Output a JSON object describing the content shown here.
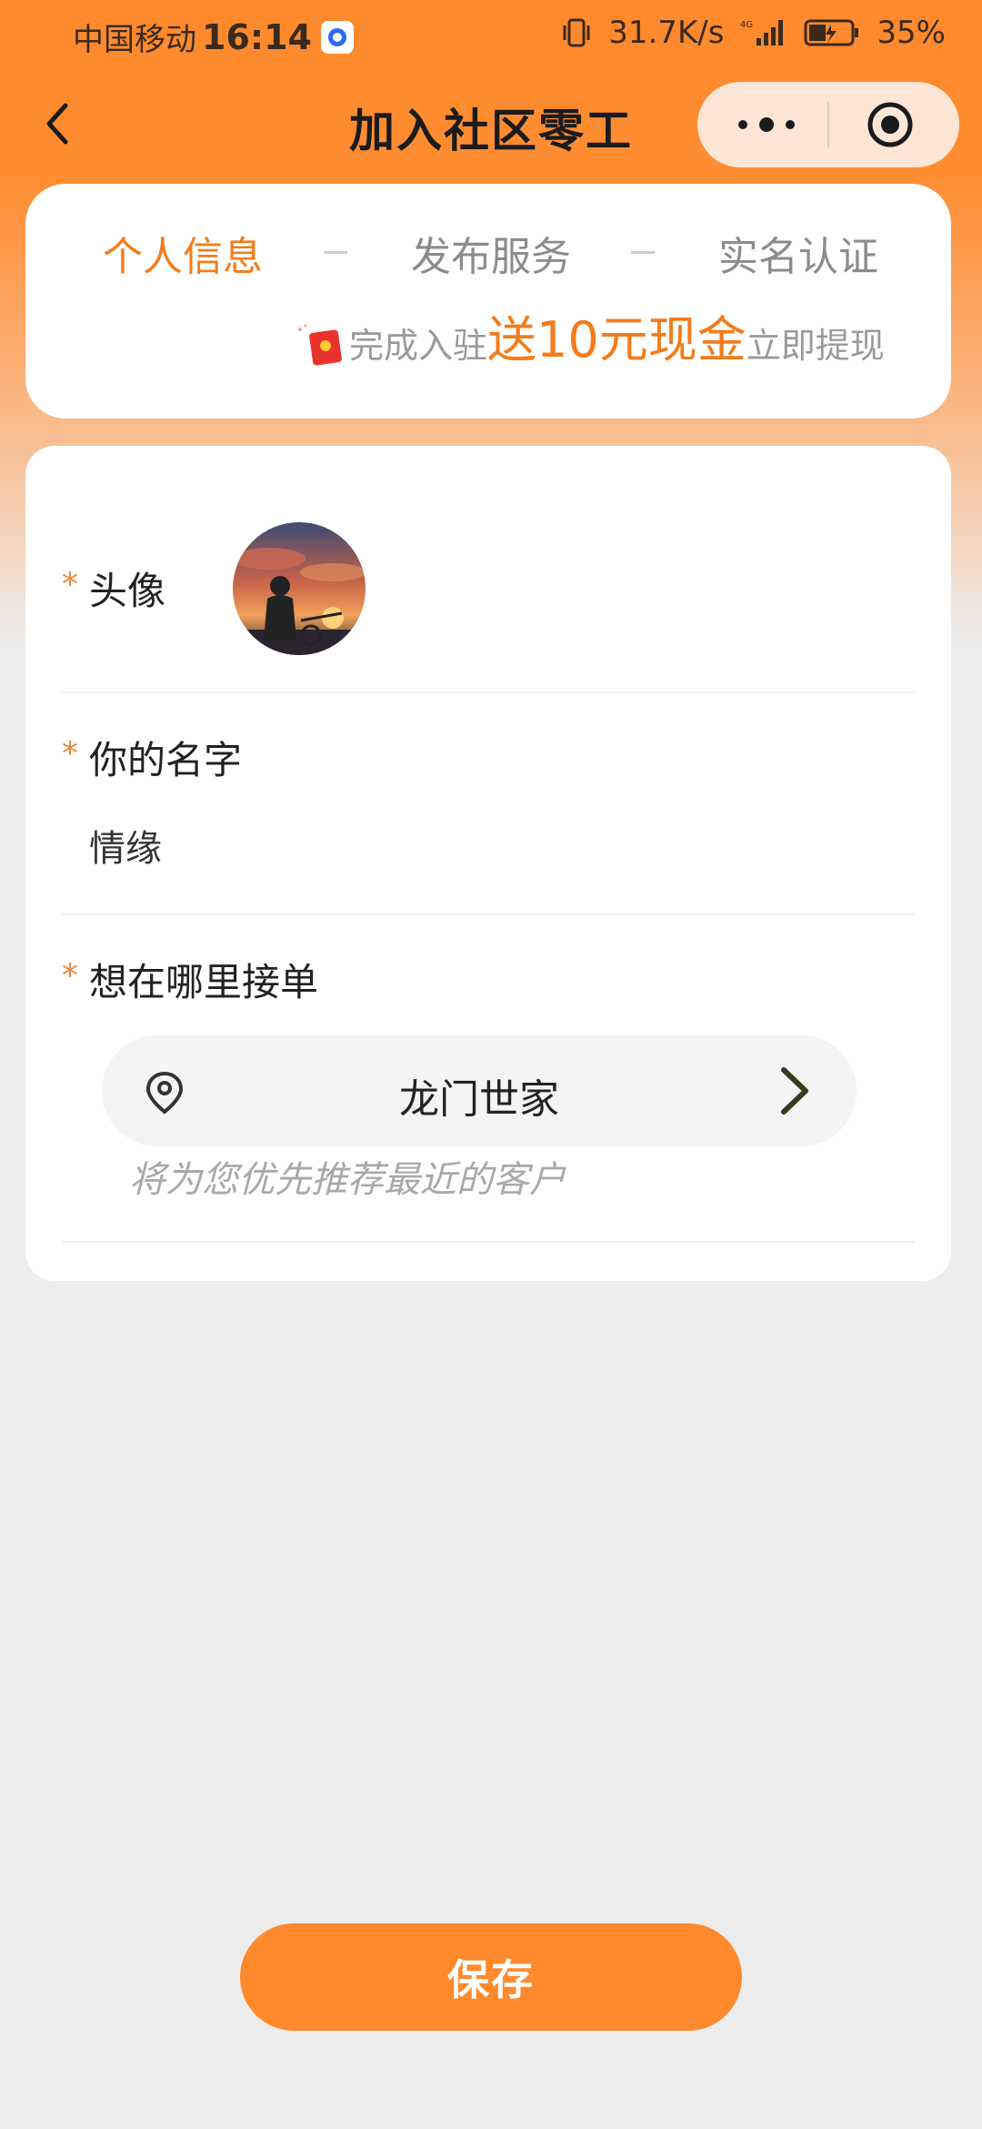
{
  "status_bar": {
    "carrier": "中国移动",
    "time": "16:14",
    "net_speed": "31.7K/s",
    "battery": "35%"
  },
  "nav": {
    "title": "加入社区零工"
  },
  "steps": [
    {
      "label": "个人信息",
      "active": true
    },
    {
      "label": "发布服务",
      "active": false
    },
    {
      "label": "实名认证",
      "active": false
    }
  ],
  "promo": {
    "prefix": "完成入驻",
    "highlight": "送10元现金",
    "suffix": "立即提现"
  },
  "form": {
    "avatar_label": "头像",
    "name_label": "你的名字",
    "name_value": "情缘",
    "location_label": "想在哪里接单",
    "location_value": "龙门世家",
    "location_hint": "将为您优先推荐最近的客户",
    "required_mark": "*"
  },
  "save_button": "保存",
  "colors": {
    "accent": "#ff8a2e",
    "tab_active": "#f47c1b",
    "underline": "#ffd21e"
  }
}
